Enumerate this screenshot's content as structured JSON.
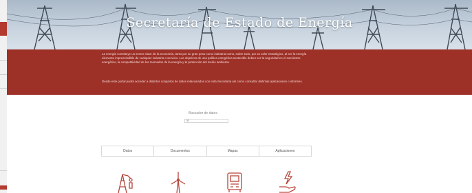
{
  "header": {
    "title": "Secretaría de Estado de Energía"
  },
  "intro": {
    "paragraph1": "La energía constituye un sector clave de la economía, tanto por su gran peso como industria como, sobre todo, por su valor estratégico, al ser la energía elemento imprescindible de cualquier industria o servicio. Los objetivos de una política energética sostenible deben ser la seguridad en el suministro energético, la competitividad de los mercados de la energía y la protección del medio ambiente.",
    "paragraph2": "Desde este portal podrá acceder a distintos conjuntos de datos relacionados con esta Secretaría así como consultar distintas aplicaciones o informes."
  },
  "search": {
    "label": "Buscador de datos",
    "value": "",
    "placeholder": ""
  },
  "tabs": [
    {
      "label": "Datos"
    },
    {
      "label": "Documentos"
    },
    {
      "label": "Mapas"
    },
    {
      "label": "Aplicaciones"
    }
  ],
  "icons": [
    "oil-derrick-icon",
    "wind-turbine-icon",
    "electric-meter-icon",
    "hand-energy-icon"
  ],
  "colors": {
    "accent": "#9d3027",
    "icon": "#b6453a"
  }
}
